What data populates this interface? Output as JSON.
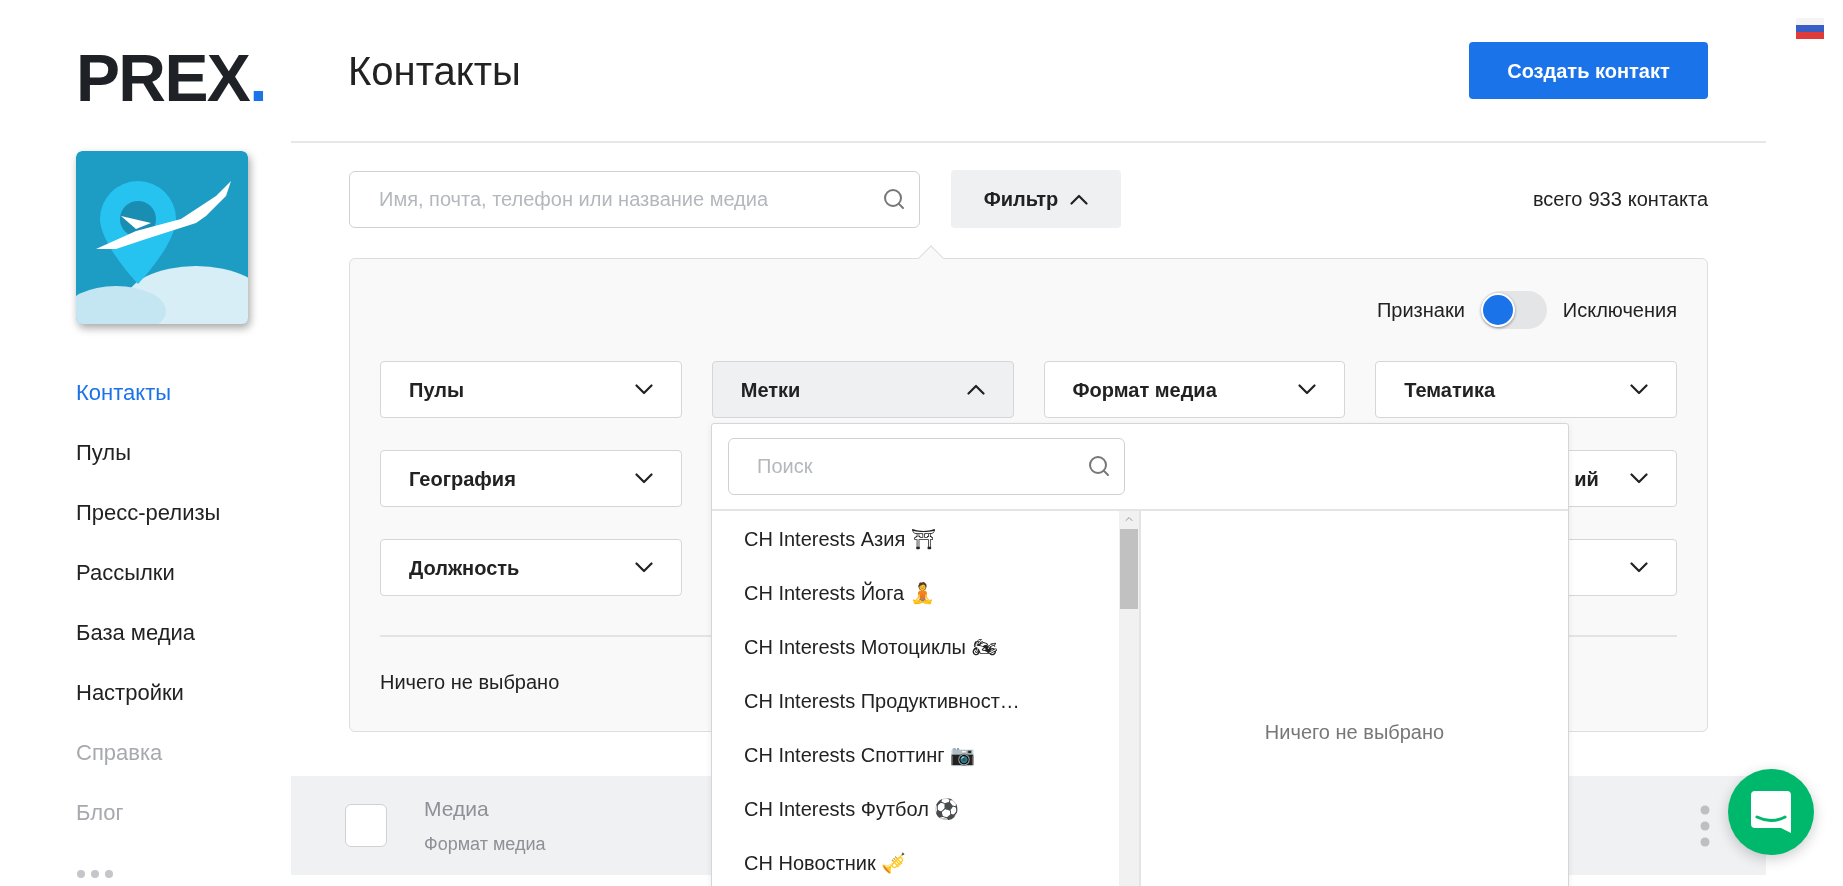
{
  "logo": {
    "text": "PREX",
    "dot": "."
  },
  "page_title": "Контакты",
  "create_button": "Создать контакт",
  "sidebar": {
    "items": [
      {
        "label": "Контакты",
        "selected": true,
        "dimmed": false
      },
      {
        "label": "Пулы",
        "selected": false,
        "dimmed": false
      },
      {
        "label": "Пресс-релизы",
        "selected": false,
        "dimmed": false
      },
      {
        "label": "Рассылки",
        "selected": false,
        "dimmed": false
      },
      {
        "label": "База медиа",
        "selected": false,
        "dimmed": false
      },
      {
        "label": "Настройки",
        "selected": false,
        "dimmed": false
      },
      {
        "label": "Справка",
        "selected": false,
        "dimmed": true
      },
      {
        "label": "Блог",
        "selected": false,
        "dimmed": true
      }
    ]
  },
  "search": {
    "placeholder": "Имя, почта, телефон или название медиа"
  },
  "filter_button": {
    "label": "Фильтр",
    "expanded": true
  },
  "total": {
    "prefix": "всего",
    "count": "933",
    "suffix": "контакта"
  },
  "filter_panel": {
    "mode_left": "Признаки",
    "mode_right": "Исключения",
    "exclusions_on": false,
    "rows": [
      [
        {
          "kind": "full",
          "label": "Пулы",
          "expanded": false
        },
        {
          "kind": "full",
          "label": "Метки",
          "expanded": true
        },
        {
          "kind": "full",
          "label": "Формат медиа",
          "expanded": false
        },
        {
          "kind": "full",
          "label": "Тематика",
          "expanded": false
        }
      ],
      [
        {
          "kind": "full",
          "label": "География",
          "expanded": false
        },
        {
          "kind": "hidden"
        },
        {
          "kind": "hidden"
        },
        {
          "kind": "partial",
          "label": "ий",
          "expanded": false
        }
      ],
      [
        {
          "kind": "full",
          "label": "Должность",
          "expanded": false
        },
        {
          "kind": "hidden"
        },
        {
          "kind": "hidden"
        },
        {
          "kind": "partial",
          "expanded": false
        }
      ]
    ],
    "summary": "Ничего не выбрано"
  },
  "tags_dropdown": {
    "search_placeholder": "Поиск",
    "options": [
      "СН Interests Азия ⛩",
      "СН Interests Йога 🧘",
      "СН Interests Мотоциклы 🏍",
      "СН Interests Продуктивност…",
      "СН Interests Споттинг 📷",
      "СН Interests Футбол ⚽",
      "СН Новостник 🎺"
    ],
    "selected_summary": "Ничего не выбрано"
  },
  "table": {
    "header": {
      "checked": false,
      "title": "Медиа",
      "subtitle": "Формат медиа"
    }
  }
}
